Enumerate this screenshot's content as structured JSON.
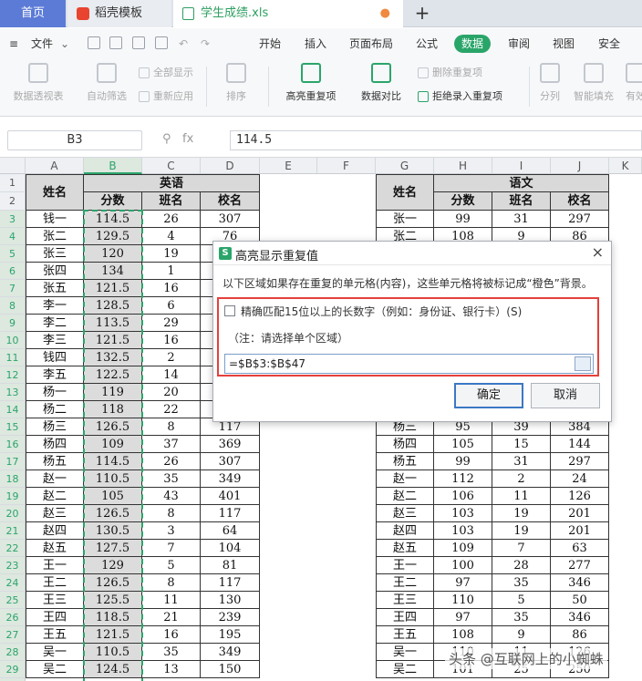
{
  "tabs": {
    "home": "首页",
    "template": "稻壳模板",
    "file": "学生成绩.xls",
    "new": "+"
  },
  "menubar": {
    "file": "文件",
    "items": [
      "开始",
      "插入",
      "页面布局",
      "公式",
      "数据",
      "审阅",
      "视图",
      "安全"
    ],
    "active_index": 4
  },
  "ribbon": {
    "pivot": "数据透视表",
    "autofilter": "自动筛选",
    "show_all": "全部显示",
    "reapply": "重新应用",
    "sort": "排序",
    "highlight_dup": "高亮重复项",
    "compare": "数据对比",
    "remove_dup": "删除重复项",
    "reject_dup": "拒绝录入重复项",
    "split": "分列",
    "smart_fill": "智能填充",
    "valid": "有效"
  },
  "formula_bar": {
    "name_box": "B3",
    "fx": "fx",
    "value": "114.5"
  },
  "columns": [
    "A",
    "B",
    "C",
    "D",
    "E",
    "F",
    "G",
    "H",
    "I",
    "J",
    "K"
  ],
  "selected_column": "B",
  "rows": [
    "1",
    "2",
    "3",
    "4",
    "5",
    "6",
    "7",
    "8",
    "9",
    "10",
    "11",
    "12",
    "13",
    "14",
    "15",
    "16",
    "17",
    "18",
    "19",
    "20",
    "21",
    "22",
    "23",
    "24",
    "25",
    "26",
    "27",
    "28",
    "29",
    "30"
  ],
  "left_table": {
    "header_name": "姓名",
    "header_group": "英语",
    "sub_headers": [
      "分数",
      "班名",
      "校名"
    ],
    "rows": [
      [
        "钱一",
        "114.5",
        "26",
        "307"
      ],
      [
        "张二",
        "129.5",
        "4",
        "76"
      ],
      [
        "张三",
        "120",
        "19",
        ""
      ],
      [
        "张四",
        "134",
        "1",
        ""
      ],
      [
        "张五",
        "121.5",
        "16",
        ""
      ],
      [
        "李一",
        "128.5",
        "6",
        ""
      ],
      [
        "李二",
        "113.5",
        "29",
        ""
      ],
      [
        "李三",
        "121.5",
        "16",
        ""
      ],
      [
        "钱四",
        "132.5",
        "2",
        ""
      ],
      [
        "李五",
        "122.5",
        "14",
        ""
      ],
      [
        "杨一",
        "119",
        "20",
        ""
      ],
      [
        "杨二",
        "118",
        "22",
        ""
      ],
      [
        "杨三",
        "126.5",
        "8",
        "117"
      ],
      [
        "杨四",
        "109",
        "37",
        "369"
      ],
      [
        "杨五",
        "114.5",
        "26",
        "307"
      ],
      [
        "赵一",
        "110.5",
        "35",
        "349"
      ],
      [
        "赵二",
        "105",
        "43",
        "401"
      ],
      [
        "赵三",
        "126.5",
        "8",
        "117"
      ],
      [
        "赵四",
        "130.5",
        "3",
        "64"
      ],
      [
        "赵五",
        "127.5",
        "7",
        "104"
      ],
      [
        "王一",
        "129",
        "5",
        "81"
      ],
      [
        "王二",
        "126.5",
        "8",
        "117"
      ],
      [
        "王三",
        "125.5",
        "11",
        "130"
      ],
      [
        "王四",
        "118.5",
        "21",
        "239"
      ],
      [
        "王五",
        "121.5",
        "16",
        "195"
      ],
      [
        "吴一",
        "110.5",
        "35",
        "349"
      ],
      [
        "吴二",
        "124.5",
        "13",
        "150"
      ]
    ]
  },
  "right_table": {
    "header_name": "姓名",
    "header_group": "语文",
    "sub_headers": [
      "分数",
      "班名",
      "校名"
    ],
    "rows": [
      [
        "张一",
        "99",
        "31",
        "297"
      ],
      [
        "张二",
        "108",
        "9",
        "86"
      ],
      [
        "",
        "",
        "",
        ""
      ],
      [
        "",
        "",
        "",
        ""
      ],
      [
        "",
        "",
        "",
        ""
      ],
      [
        "",
        "",
        "",
        ""
      ],
      [
        "",
        "",
        "",
        ""
      ],
      [
        "",
        "",
        "",
        ""
      ],
      [
        "",
        "",
        "",
        ""
      ],
      [
        "",
        "",
        "",
        ""
      ],
      [
        "",
        "",
        "",
        ""
      ],
      [
        "",
        "",
        "",
        ""
      ],
      [
        "杨三",
        "95",
        "39",
        "384"
      ],
      [
        "杨四",
        "105",
        "15",
        "144"
      ],
      [
        "杨五",
        "99",
        "31",
        "297"
      ],
      [
        "赵一",
        "112",
        "2",
        "24"
      ],
      [
        "赵二",
        "106",
        "11",
        "126"
      ],
      [
        "赵三",
        "103",
        "19",
        "201"
      ],
      [
        "赵四",
        "103",
        "19",
        "201"
      ],
      [
        "赵五",
        "109",
        "7",
        "63"
      ],
      [
        "王一",
        "100",
        "28",
        "277"
      ],
      [
        "王二",
        "97",
        "35",
        "346"
      ],
      [
        "王三",
        "110",
        "5",
        "50"
      ],
      [
        "王四",
        "97",
        "35",
        "346"
      ],
      [
        "王五",
        "108",
        "9",
        "86"
      ],
      [
        "吴一",
        "110",
        "11",
        "126"
      ],
      [
        "吴二",
        "101",
        "25",
        "250"
      ]
    ]
  },
  "dialog": {
    "title": "高亮显示重复值",
    "close": "×",
    "description": "以下区域如果存在重复的单元格(内容)，这些单元格将被标记成“橙色”背景。",
    "checkbox_label": "精确匹配15位以上的长数字（例如：身份证、银行卡）(S)",
    "note": "（注：请选择单个区域）",
    "range_value": "=$B$3:$B$47",
    "ok": "确定",
    "cancel": "取消"
  },
  "watermark": "头条 @互联网上的小蜘蛛",
  "colors": {
    "accent": "#2aa56a",
    "highlight_border": "#e5403c",
    "home_tab": "#5b7bd6"
  }
}
